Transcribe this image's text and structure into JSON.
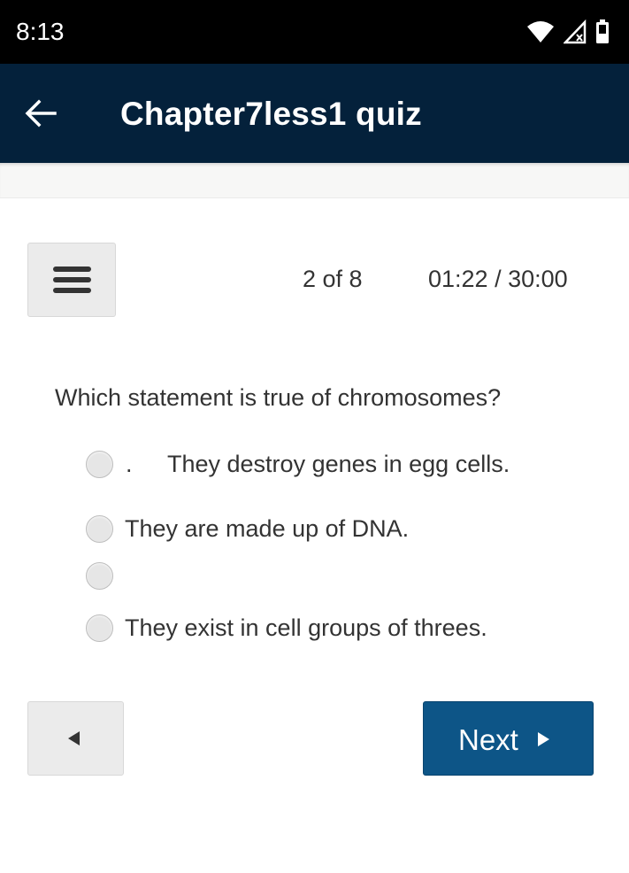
{
  "status_bar": {
    "time": "8:13",
    "icons": [
      "wifi-icon",
      "cellular-no-signal-icon",
      "battery-icon"
    ]
  },
  "app_bar": {
    "back_icon": "arrow-left-icon",
    "title": "Chapter7less1 quiz"
  },
  "quiz": {
    "menu_icon": "hamburger-menu-icon",
    "progress": "2 of 8",
    "timer": "01:22 / 30:00",
    "question": "Which statement is true of chromosomes?",
    "options": [
      {
        "prefix": ".",
        "label": "They destroy genes in egg cells.",
        "selected": false
      },
      {
        "prefix": "",
        "label": "They are made up of DNA.",
        "selected": false
      },
      {
        "prefix": "",
        "label": "",
        "selected": false
      },
      {
        "prefix": "",
        "label": "They exist in cell groups of threes.",
        "selected": false
      }
    ]
  },
  "navigation": {
    "prev_icon": "triangle-left-icon",
    "next_label": "Next",
    "next_icon": "triangle-right-icon"
  },
  "colors": {
    "app_bar_bg": "#04213b",
    "next_button_bg": "#0d5587",
    "neutral_button_bg": "#ebebeb",
    "text": "#333333"
  }
}
